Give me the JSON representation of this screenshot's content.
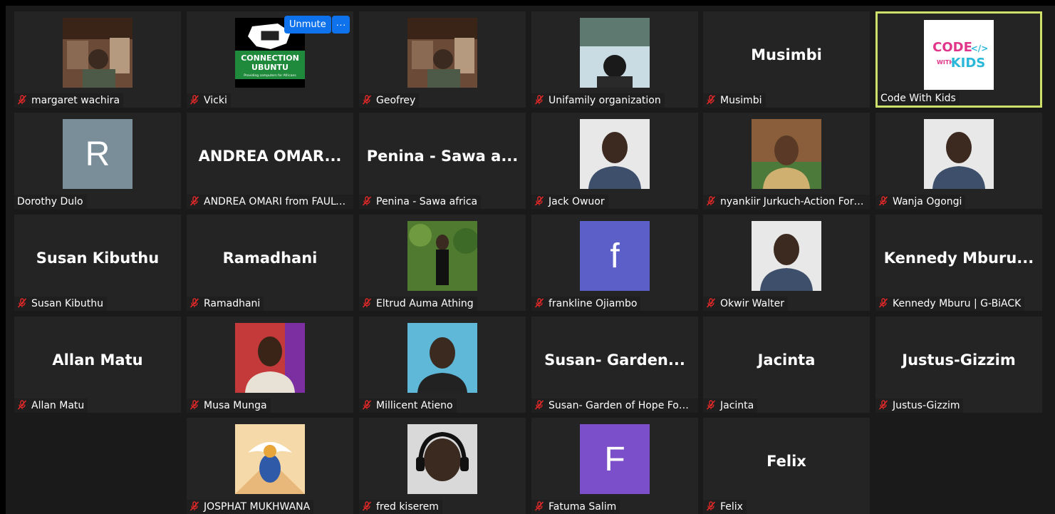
{
  "controls": {
    "unmute_label": "Unmute",
    "more_label": "···"
  },
  "accent": {
    "active_border": "#cfe06a",
    "button_blue": "#0e72ed",
    "muted_red": "#e02828"
  },
  "participants": [
    {
      "name": "margaret wachira",
      "muted": true,
      "video": "room"
    },
    {
      "name": "Vicki",
      "muted": true,
      "video": "connection-ubuntu-logo",
      "logo_lines": [
        "CONNECTION",
        "UBUNTU",
        "Providing computers for Africans"
      ]
    },
    {
      "name": "Geofrey",
      "muted": true,
      "video": "room"
    },
    {
      "name": "Unifamily organization",
      "muted": true,
      "video": "sky-silhouette"
    },
    {
      "name": "Musimbi",
      "muted": true,
      "display_text": "Musimbi"
    },
    {
      "name": "Code With Kids",
      "muted": false,
      "active": true,
      "video": "code-with-kids-logo",
      "logo_lines": [
        "CODE",
        "WITH",
        "KIDS"
      ]
    },
    {
      "name": "Dorothy Dulo",
      "muted": false,
      "avatar_letter": "R",
      "avatar_color": "#7a8e99"
    },
    {
      "name": "ANDREA OMARI from FAULU...",
      "muted": true,
      "display_text": "ANDREA  OMAR..."
    },
    {
      "name": "Penina - Sawa africa",
      "muted": true,
      "display_text": "Penina - Sawa a..."
    },
    {
      "name": "Jack Owuor",
      "muted": true,
      "video": "portrait"
    },
    {
      "name": "nyankiir Jurkuch-Action For ...",
      "muted": true,
      "video": "portrait-outdoor"
    },
    {
      "name": "Wanja Ogongi",
      "muted": true,
      "video": "portrait"
    },
    {
      "name": "Susan Kibuthu",
      "muted": true,
      "display_text": "Susan Kibuthu"
    },
    {
      "name": "Ramadhani",
      "muted": true,
      "display_text": "Ramadhani"
    },
    {
      "name": "Eltrud Auma Athing",
      "muted": true,
      "video": "portrait-garden"
    },
    {
      "name": "frankline Ojiambo",
      "muted": true,
      "avatar_letter": "f",
      "avatar_color": "#5b5fc7"
    },
    {
      "name": "Okwir Walter",
      "muted": true,
      "video": "portrait"
    },
    {
      "name": "Kennedy Mburu | G-BiACK",
      "muted": true,
      "display_text": "Kennedy  Mburu..."
    },
    {
      "name": "Allan Matu",
      "muted": true,
      "display_text": "Allan Matu"
    },
    {
      "name": "Musa Munga",
      "muted": true,
      "video": "portrait-red"
    },
    {
      "name": "Millicent Atieno",
      "muted": true,
      "video": "portrait-blue"
    },
    {
      "name": "Susan- Garden of Hope Fou...",
      "muted": true,
      "display_text": "Susan-  Garden..."
    },
    {
      "name": "Jacinta",
      "muted": true,
      "display_text": "Jacinta"
    },
    {
      "name": "Justus-Gizzim",
      "muted": true,
      "display_text": "Justus-Gizzim"
    },
    {
      "name": "JOSPHAT MUKHWANA",
      "muted": true,
      "video": "scarab-illustration"
    },
    {
      "name": "fred kiserem",
      "muted": true,
      "video": "portrait-headphones"
    },
    {
      "name": "Fatuma Salim",
      "muted": true,
      "avatar_letter": "F",
      "avatar_color": "#7b4fc9"
    },
    {
      "name": "Felix",
      "muted": true,
      "display_text": "Felix"
    }
  ]
}
